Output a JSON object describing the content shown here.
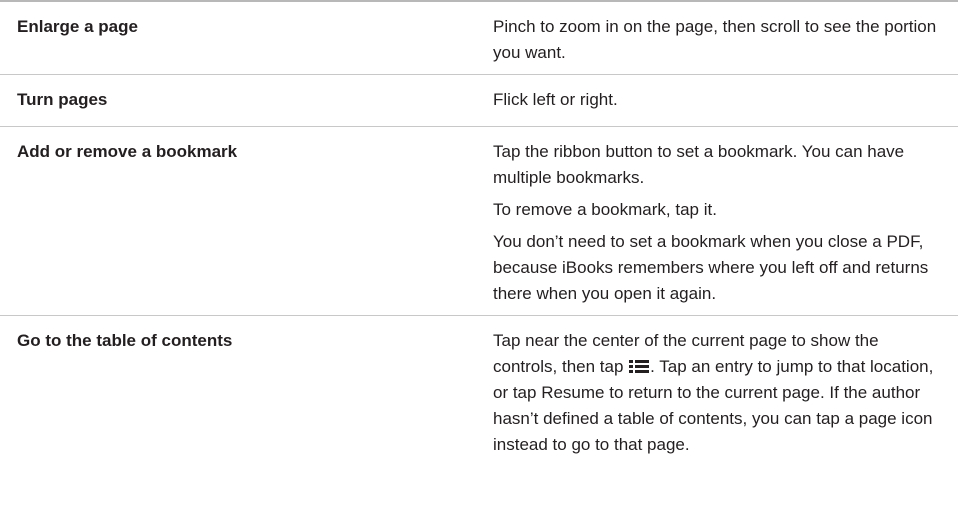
{
  "rows": [
    {
      "action": "Enlarge a page",
      "desc": [
        "Pinch to zoom in on the page, then scroll to see the portion you want."
      ]
    },
    {
      "action": "Turn pages",
      "desc": [
        "Flick left or right."
      ]
    },
    {
      "action": "Add or remove a bookmark",
      "desc": [
        "Tap the ribbon button to set a bookmark. You can have multiple bookmarks.",
        "To remove a bookmark, tap it.",
        "You don’t need to set a bookmark when you close a PDF, because iBooks remembers where you left off and returns there when you open it again."
      ]
    },
    {
      "action": "Go to the table of contents",
      "desc_before_icon": "Tap near the center of the current page to show the controls, then tap",
      "icon": "list-icon",
      "desc_after_icon": ". Tap an entry to jump to that location, or tap Resume to return to the current page. If the author hasn’t defined a table of contents, you can tap a page icon instead to go to that page."
    }
  ]
}
